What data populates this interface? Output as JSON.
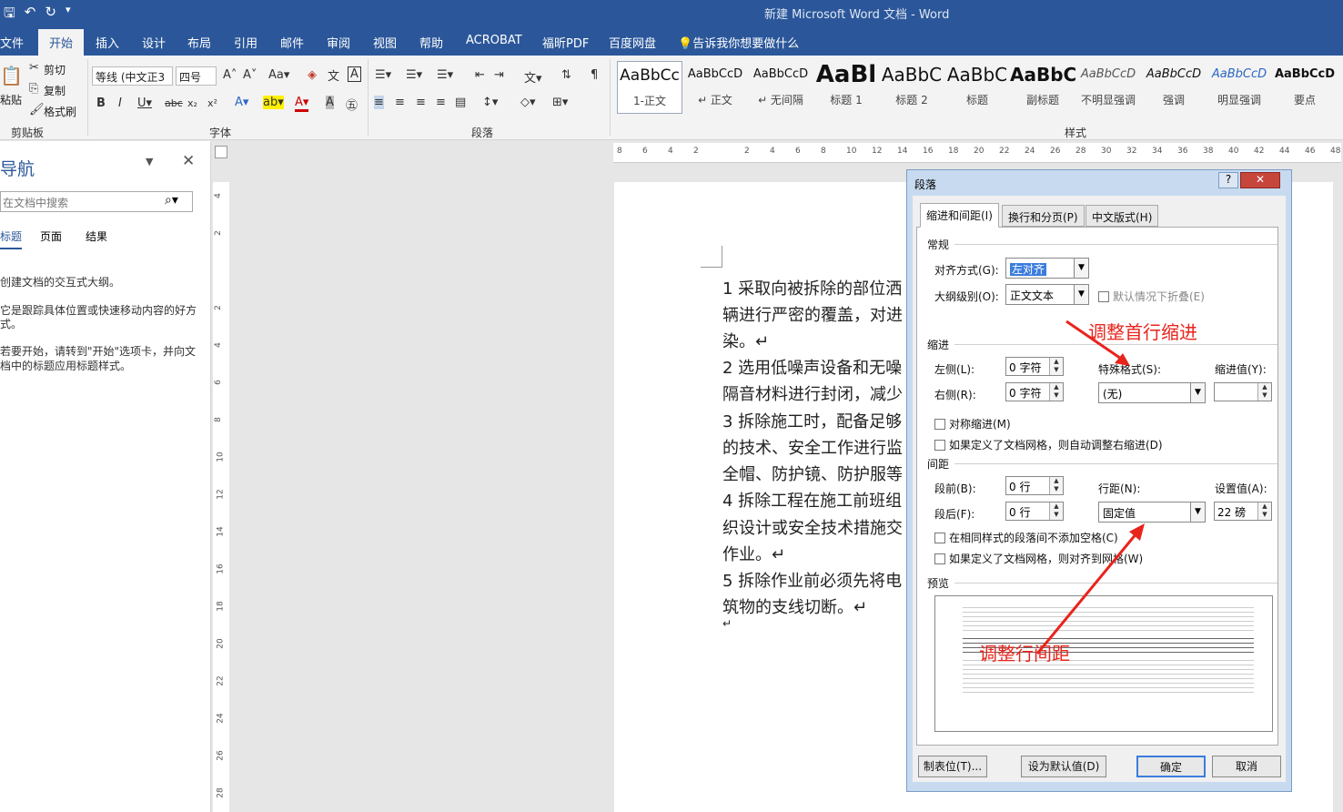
{
  "window": {
    "title": "新建 Microsoft Word 文档  -  Word"
  },
  "tabs": [
    "文件",
    "开始",
    "插入",
    "设计",
    "布局",
    "引用",
    "邮件",
    "审阅",
    "视图",
    "帮助",
    "ACROBAT",
    "福昕PDF",
    "百度网盘"
  ],
  "tell_me": "告诉我你想要做什么",
  "clipboard": {
    "paste": "粘贴",
    "cut": "剪切",
    "copy": "复制",
    "format_painter": "格式刷",
    "label": "剪贴板"
  },
  "font": {
    "name": "等线 (中文正3",
    "size": "四号",
    "label": "字体"
  },
  "paragraph_label": "段落",
  "styles_label": "样式",
  "styles": [
    {
      "preview": "AaBbCc",
      "name": "1-正文"
    },
    {
      "preview": "AaBbCcD",
      "name": "↵ 正文"
    },
    {
      "preview": "AaBbCcD",
      "name": "↵ 无间隔"
    },
    {
      "preview": "AaBl",
      "name": "标题 1"
    },
    {
      "preview": "AaBbC",
      "name": "标题 2"
    },
    {
      "preview": "AaBbC",
      "name": "标题"
    },
    {
      "preview": "AaBbC",
      "name": "副标题"
    },
    {
      "preview": "AaBbCcD",
      "name": "不明显强调"
    },
    {
      "preview": "AaBbCcD",
      "name": "强调"
    },
    {
      "preview": "AaBbCcD",
      "name": "明显强调"
    },
    {
      "preview": "AaBbCcD",
      "name": "要点"
    }
  ],
  "nav": {
    "title": "导航",
    "search_placeholder": "在文档中搜索",
    "tabs": [
      "标题",
      "页面",
      "结果"
    ],
    "msg1": "创建文档的交互式大纲。",
    "msg2a": "它是跟踪具体位置或快速移动内容的好方",
    "msg2b": "式。",
    "msg3a": "若要开始，请转到\"开始\"选项卡，并向文",
    "msg3b": "档中的标题应用标题样式。"
  },
  "doc_lines": [
    "1   采取向被拆除的部位洒",
    "辆进行严密的覆盖，对进",
    "染。↵",
    "2   选用低噪声设备和无噪",
    "隔音材料进行封闭，减少",
    "3   拆除施工时，配备足够",
    "的技术、安全工作进行监",
    "全帽、防护镜、防护服等",
    "4   拆除工程在施工前班组",
    "织设计或安全技术措施交",
    "作业。↵",
    "5   拆除作业前必须先将电",
    "筑物的支线切断。↵",
    "↵"
  ],
  "ruler_h": [
    "8",
    "6",
    "4",
    "2",
    "",
    "2",
    "4",
    "6",
    "8",
    "10",
    "12",
    "14",
    "16",
    "18",
    "20",
    "22",
    "24",
    "26",
    "28",
    "30",
    "32",
    "34",
    "36",
    "38",
    "40",
    "42",
    "44",
    "46",
    "48"
  ],
  "ruler_v": [
    "4",
    "2",
    "",
    "2",
    "4",
    "6",
    "8",
    "10",
    "12",
    "14",
    "16",
    "18",
    "20",
    "22",
    "24",
    "26",
    "28"
  ],
  "dialog": {
    "title": "段落",
    "tabs": [
      "缩进和间距(I)",
      "换行和分页(P)",
      "中文版式(H)"
    ],
    "general": "常规",
    "alignment_label": "对齐方式(G):",
    "alignment_value": "左对齐",
    "outline_label": "大纲级别(O):",
    "outline_value": "正文文本",
    "collapse_label": "默认情况下折叠(E)",
    "indent": "缩进",
    "left_label": "左侧(L):",
    "left_value": "0 字符",
    "right_label": "右侧(R):",
    "right_value": "0 字符",
    "special_label": "特殊格式(S):",
    "special_value": "(无)",
    "indent_by_label": "缩进值(Y):",
    "mirror_label": "对称缩进(M)",
    "auto_right_label": "如果定义了文档网格，则自动调整右缩进(D)",
    "spacing": "间距",
    "before_label": "段前(B):",
    "before_value": "0 行",
    "after_label": "段后(F):",
    "after_value": "0 行",
    "line_label": "行距(N):",
    "line_value": "固定值",
    "at_label": "设置值(A):",
    "at_value": "22 磅",
    "nospace_label": "在相同样式的段落间不添加空格(C)",
    "snap_label": "如果定义了文档网格，则对齐到网格(W)",
    "preview": "预览",
    "btn_tabs": "制表位(T)...",
    "btn_default": "设为默认值(D)",
    "btn_ok": "确定",
    "btn_cancel": "取消"
  },
  "annotations": {
    "first_indent": "调整首行缩进",
    "line_spacing": "调整行间距"
  },
  "colors": {
    "brand": "#2b579a",
    "annotation": "#e8241c"
  }
}
